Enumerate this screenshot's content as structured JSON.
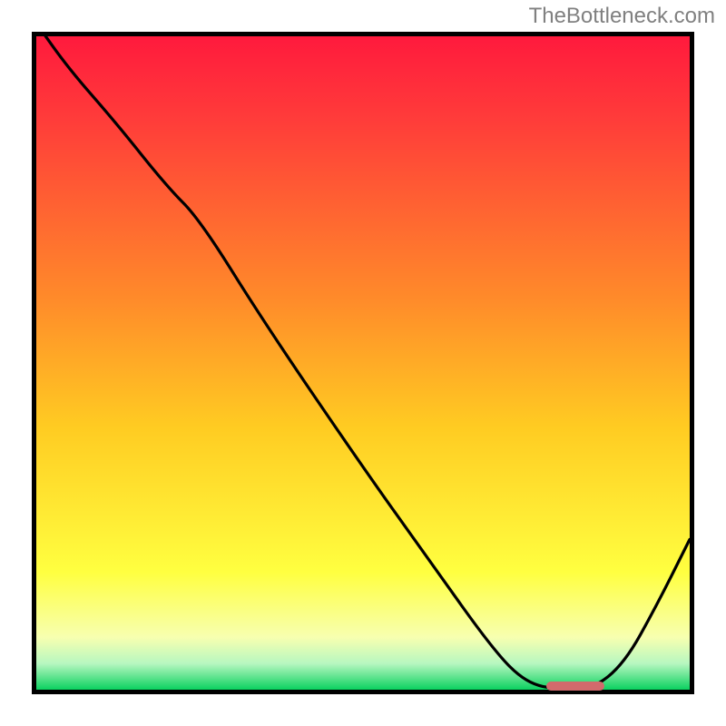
{
  "attribution": "TheBottleneck.com",
  "chart_data": {
    "type": "line",
    "title": "",
    "xlabel": "",
    "ylabel": "",
    "xlim": [
      0,
      1
    ],
    "ylim": [
      0,
      1
    ],
    "x": [
      0.0,
      0.05,
      0.12,
      0.2,
      0.25,
      0.35,
      0.5,
      0.6,
      0.7,
      0.75,
      0.8,
      0.85,
      0.9,
      0.95,
      1.0
    ],
    "values": [
      1.02,
      0.95,
      0.87,
      0.77,
      0.72,
      0.56,
      0.34,
      0.2,
      0.06,
      0.01,
      0.0,
      0.0,
      0.04,
      0.13,
      0.23
    ],
    "optimal_range_x": [
      0.78,
      0.87
    ],
    "optimal_y": 0.005
  },
  "gradient": {
    "stops": [
      {
        "offset": "0%",
        "color": "#ff1a3d"
      },
      {
        "offset": "12%",
        "color": "#ff3a3a"
      },
      {
        "offset": "40%",
        "color": "#ff8a2a"
      },
      {
        "offset": "60%",
        "color": "#ffcc22"
      },
      {
        "offset": "82%",
        "color": "#ffff40"
      },
      {
        "offset": "92%",
        "color": "#f7ffb0"
      },
      {
        "offset": "96%",
        "color": "#b7f7c0"
      },
      {
        "offset": "100%",
        "color": "#0bd160"
      }
    ]
  },
  "marker_color": "#d26a6c"
}
